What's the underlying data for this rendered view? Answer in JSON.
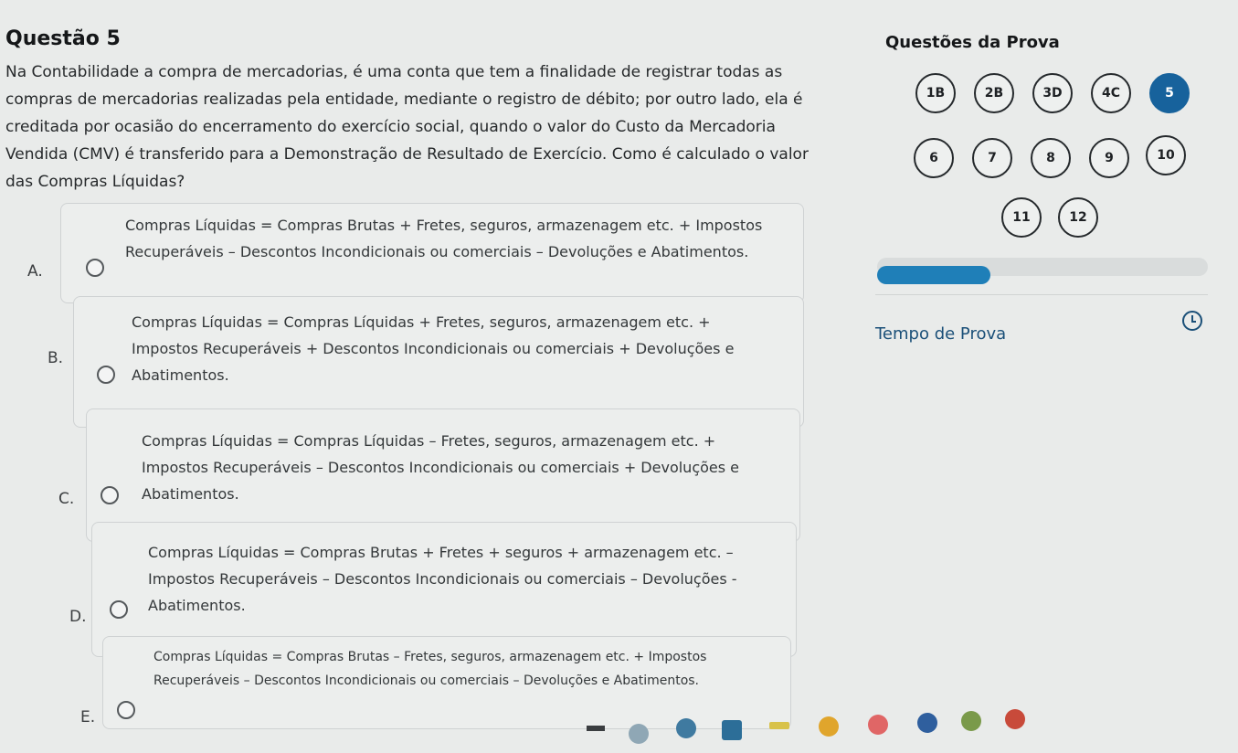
{
  "question": {
    "title": "Questão 5",
    "text_lines": [
      "Na Contabilidade a compra de mercadorias, é uma conta que tem a finalidade de registrar todas as",
      "compras de mercadorias realizadas pela entidade, mediante o registro de débito; por outro lado, ela é",
      "creditada por ocasião do encerramento do exercício social, quando o valor do Custo da Mercadoria",
      "Vendida (CMV) é transferido para a Demonstração de Resultado de Exercício. Como é calculado o valor",
      "das Compras Líquidas?"
    ]
  },
  "options": [
    {
      "letter": "A.",
      "lines": [
        "Compras Líquidas = Compras Brutas + Fretes, seguros, armazenagem etc. + Impostos",
        "Recuperáveis – Descontos Incondicionais ou comerciais – Devoluções e Abatimentos."
      ]
    },
    {
      "letter": "B.",
      "lines": [
        "Compras Líquidas = Compras Líquidas + Fretes, seguros, armazenagem etc. +",
        "Impostos Recuperáveis + Descontos Incondicionais ou comerciais + Devoluções e",
        "Abatimentos."
      ]
    },
    {
      "letter": "C.",
      "lines": [
        "Compras Líquidas = Compras Líquidas – Fretes, seguros, armazenagem etc. +",
        "Impostos Recuperáveis – Descontos Incondicionais ou comerciais + Devoluções e",
        "Abatimentos."
      ]
    },
    {
      "letter": "D.",
      "lines": [
        "Compras Líquidas = Compras Brutas + Fretes + seguros + armazenagem etc. –",
        "Impostos Recuperáveis – Descontos Incondicionais ou comerciais – Devoluções -",
        "Abatimentos."
      ]
    },
    {
      "letter": "E.",
      "lines": [
        "Compras Líquidas = Compras Brutas – Fretes, seguros, armazenagem etc. + Impostos",
        "Recuperáveis – Descontos Incondicionais ou comerciais – Devoluções e Abatimentos."
      ]
    }
  ],
  "panel": {
    "title": "Questões da Prova",
    "buttons": [
      "1B",
      "2B",
      "3D",
      "4C",
      "5",
      "6",
      "7",
      "8",
      "9",
      "10",
      "11",
      "12"
    ],
    "active": "5",
    "progress_fraction": 0.34,
    "timer_label": "Tempo de Prova"
  },
  "colors": {
    "accent": "#17629c",
    "progress": "#1f7fb8",
    "background": "#e9ebea"
  },
  "icons": {
    "timer": "clock-icon"
  }
}
